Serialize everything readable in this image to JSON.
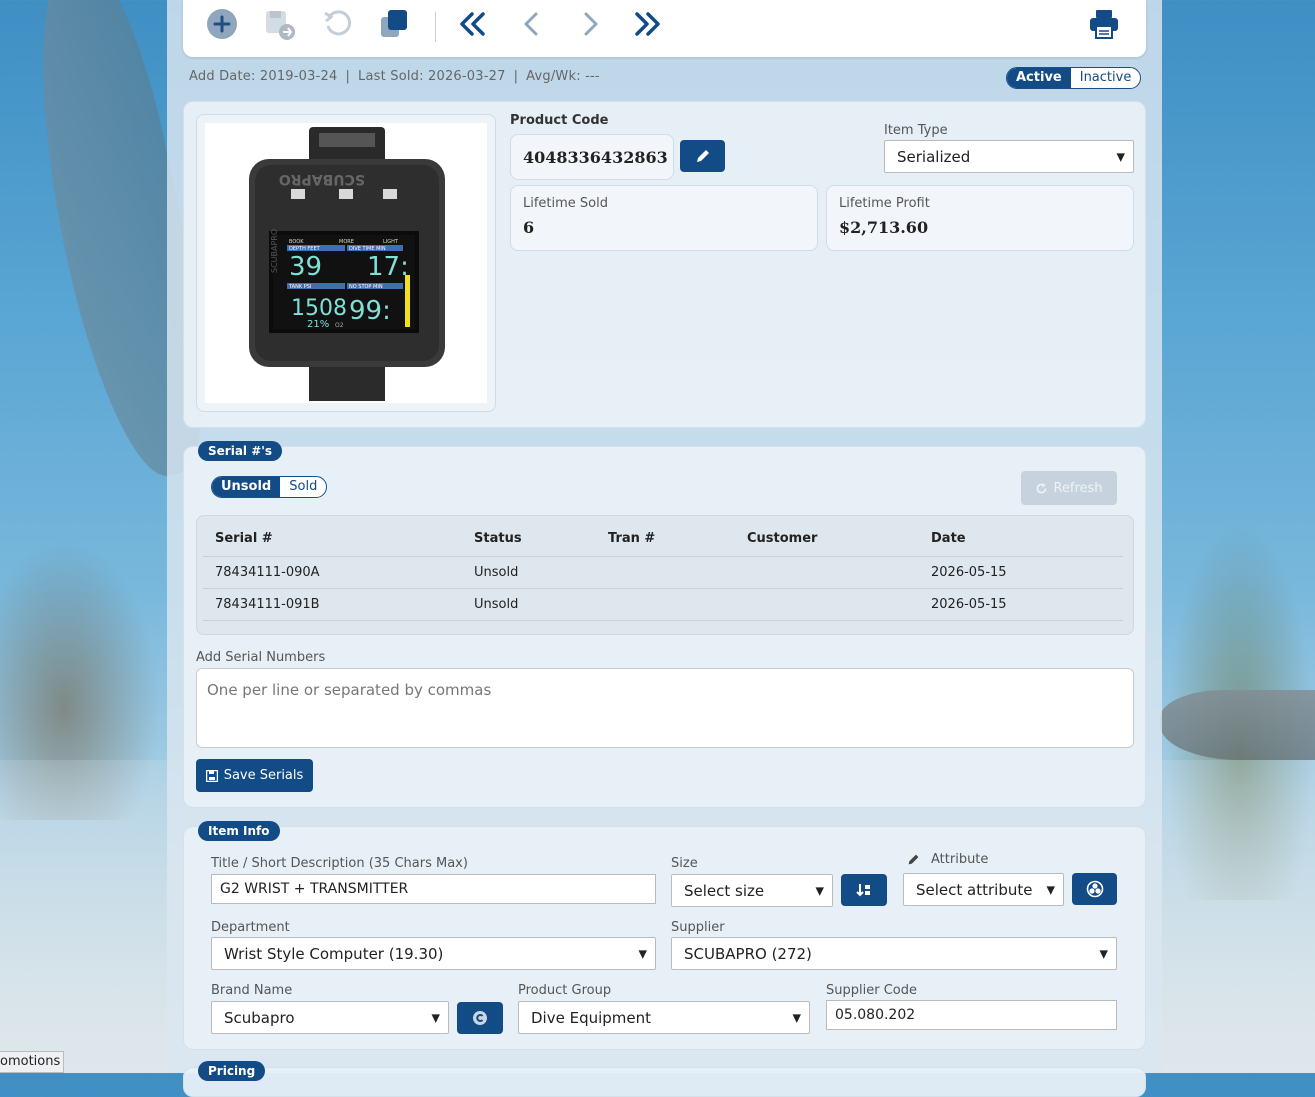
{
  "toolbar": {
    "buttons": [
      "add-icon",
      "save-duplicate-icon",
      "undo-icon",
      "copy-icon",
      "first-icon",
      "previous-icon",
      "next-icon",
      "last-icon",
      "print-icon"
    ]
  },
  "meta": {
    "add_date": "Add Date: 2019-03-24",
    "last_sold": "Last Sold: 2026-03-27",
    "avg_wk": "Avg/Wk: ---",
    "sep": "|"
  },
  "status_toggle": {
    "active": "Active",
    "inactive": "Inactive"
  },
  "product": {
    "code_label": "Product Code",
    "code": "4048336432863",
    "item_type_label": "Item Type",
    "item_type": "Serialized",
    "lifetime_sold_label": "Lifetime Sold",
    "lifetime_sold": "6",
    "lifetime_profit_label": "Lifetime Profit",
    "lifetime_profit": "$2,713.60",
    "image_brand": "SCUBAPRO",
    "screen": {
      "top_labels": [
        "BOOK",
        "MORE",
        "LIGHT"
      ],
      "depth_label": "DEPTH   FEET",
      "dive_label": "DIVE TIME  MIN",
      "depth": "39",
      "dive_time": "17:",
      "tank_label": "TANK   PSI",
      "nostop_label": "NO STOP  MIN",
      "tank": "1508",
      "nostop": "99:",
      "o2": "21%",
      "o2_unit": "O2"
    }
  },
  "serials": {
    "section_label": "Serial #'s",
    "tab_unsold": "Unsold",
    "tab_sold": "Sold",
    "refresh_label": "Refresh",
    "columns": [
      "Serial #",
      "Status",
      "Tran #",
      "Customer",
      "Date"
    ],
    "rows": [
      {
        "serial": "78434111-090A",
        "status": "Unsold",
        "tran": "",
        "customer": "",
        "date": "2026-05-15"
      },
      {
        "serial": "78434111-091B",
        "status": "Unsold",
        "tran": "",
        "customer": "",
        "date": "2026-05-15"
      }
    ],
    "add_label": "Add Serial Numbers",
    "add_placeholder": "One per line or separated by commas",
    "save_label": "Save Serials"
  },
  "item_info": {
    "section_label": "Item Info",
    "title_label": "Title / Short Description (35 Chars Max)",
    "title_value": "G2 WRIST + TRANSMITTER",
    "size_label": "Size",
    "size_value": "Select size",
    "attribute_label": "Attribute",
    "attribute_value": "Select attribute",
    "department_label": "Department",
    "department_value": "Wrist Style Computer (19.30)",
    "supplier_label": "Supplier",
    "supplier_value": "SCUBAPRO (272)",
    "brand_label": "Brand Name",
    "brand_value": "Scubapro",
    "group_label": "Product Group",
    "group_value": "Dive Equipment",
    "supplier_code_label": "Supplier Code",
    "supplier_code_value": "05.080.202"
  },
  "pricing": {
    "section_label": "Pricing"
  },
  "corner_tab": "omotions",
  "colors": {
    "primary": "#124b85",
    "panel": "#e8f0f7"
  }
}
